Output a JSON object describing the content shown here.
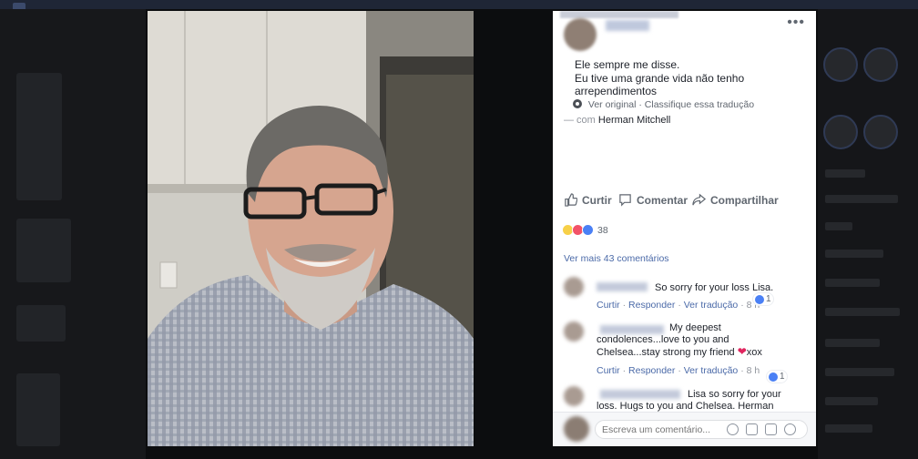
{
  "post": {
    "text_lines": [
      "Ele sempre me disse.",
      "Eu tive uma grande vida não tenho",
      "arrependimentos"
    ],
    "see_original": "Ver original",
    "rate_translation": "Classifique essa tradução",
    "with_prefix": "— com",
    "tagged_name": "Herman Mitchell"
  },
  "actions": {
    "like": "Curtir",
    "comment": "Comentar",
    "share": "Compartilhar"
  },
  "reactions": {
    "types": [
      "sad",
      "love",
      "like"
    ],
    "count": "38"
  },
  "view_more_comments": "Ver mais 43 comentários",
  "comments": [
    {
      "text_lines": [
        "So sorry for your loss Lisa."
      ],
      "like": "Curtir",
      "reply": "Responder",
      "see_translation": "Ver tradução",
      "time": "8 h",
      "like_count": "1"
    },
    {
      "text_lines": [
        "My deepest",
        "condolences...love to you and",
        "Chelsea...stay strong my friend"
      ],
      "suffix": "xox",
      "like": "Curtir",
      "reply": "Responder",
      "see_translation": "Ver tradução",
      "time": "8 h",
      "like_count": "1"
    },
    {
      "text_lines": [
        "Lisa so sorry for your",
        "loss. Hugs to you and Chelsea. Herman"
      ]
    }
  ],
  "composer": {
    "placeholder": "Escreva um comentário..."
  },
  "colors": {
    "link": "#4b6aa8",
    "like_blue": "#4a80f5",
    "heart": "#e0245e"
  }
}
